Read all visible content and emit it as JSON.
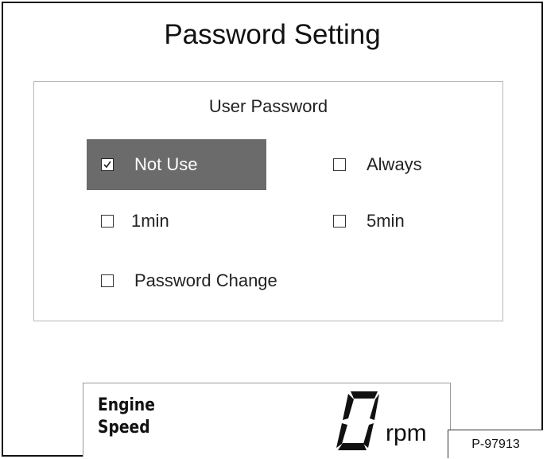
{
  "title": "Password Setting",
  "user_password": {
    "heading": "User Password",
    "options": [
      {
        "label": "Not Use",
        "checked": true,
        "selected": true
      },
      {
        "label": "Always",
        "checked": false,
        "selected": false
      },
      {
        "label": "1min",
        "checked": false,
        "selected": false
      },
      {
        "label": "5min",
        "checked": false,
        "selected": false
      },
      {
        "label": "Password Change",
        "checked": false,
        "selected": false
      }
    ]
  },
  "engine_speed": {
    "label_line1": "Engine",
    "label_line2": "Speed",
    "value": "0",
    "unit": "rpm"
  },
  "figure_ref": "P-97913",
  "colors": {
    "selected_background": "#6b6b6b",
    "selected_text": "#ffffff",
    "border": "#111111"
  },
  "icons": [
    "checkbox-checked-icon",
    "checkbox-empty-icon"
  ]
}
